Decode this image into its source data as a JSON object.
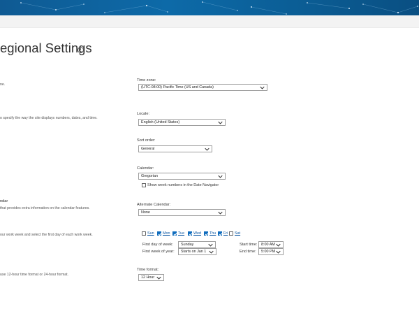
{
  "page": {
    "title": "egional Settings"
  },
  "sections": {
    "timezone": {
      "desc": "ne.",
      "label": "Time zone:",
      "value": "(UTC-08:00) Pacific Time (US and Canada)"
    },
    "locale": {
      "desc": "o specify the way the site displays numbers, dates, and time.",
      "label": "Locale:",
      "value": "English (United States)"
    },
    "sort": {
      "label": "Sort order:",
      "value": "General"
    },
    "calendar": {
      "label": "Calendar:",
      "value": "Gregorian",
      "week_numbers_label": "Show week numbers in the Date Navigator",
      "week_numbers_checked": false
    },
    "alt_calendar": {
      "title": "ndar",
      "desc": "that provides extra information on the calendar features.",
      "label": "Alternate Calendar:",
      "value": "None"
    },
    "work_week": {
      "desc": "our work week and select the first day of each work week.",
      "days": [
        {
          "label": "Sun",
          "checked": false
        },
        {
          "label": "Mon",
          "checked": true
        },
        {
          "label": "Tue",
          "checked": true
        },
        {
          "label": "Wed",
          "checked": true
        },
        {
          "label": "Thu",
          "checked": true
        },
        {
          "label": "Fri",
          "checked": true
        },
        {
          "label": "Sat",
          "checked": false
        }
      ],
      "first_day_label": "First day of week:",
      "first_day_value": "Sunday",
      "first_week_label": "First week of year:",
      "first_week_value": "Starts on Jan 1",
      "start_time_label": "Start time:",
      "start_time_value": "8:00 AM",
      "end_time_label": "End time:",
      "end_time_value": "5:00 PM"
    },
    "time_format": {
      "desc": "use 12-hour time format or 24-hour format.",
      "label": "Time format:",
      "value": "12 Hour"
    }
  },
  "colors": {
    "banner": "#0d6aa8",
    "accent": "#0f6cbd"
  }
}
